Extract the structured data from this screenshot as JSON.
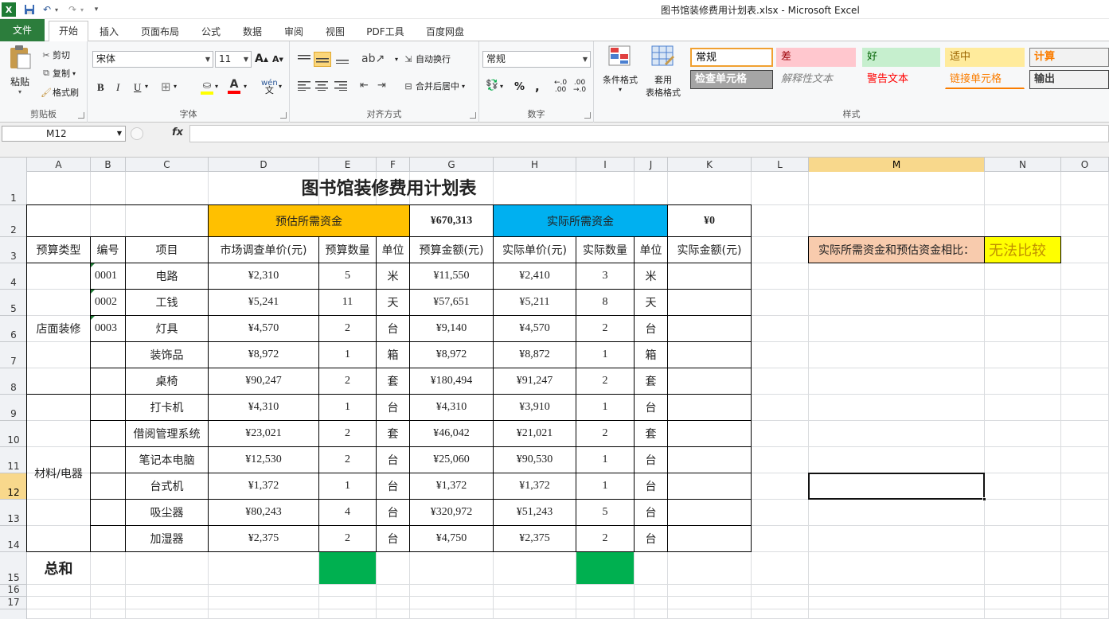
{
  "window": {
    "title": "图书馆装修费用计划表.xlsx - Microsoft Excel"
  },
  "tabs": [
    "文件",
    "开始",
    "插入",
    "页面布局",
    "公式",
    "数据",
    "审阅",
    "视图",
    "PDF工具",
    "百度网盘"
  ],
  "ribbon": {
    "clipboard": {
      "label": "剪贴板",
      "paste": "粘贴",
      "cut": "剪切",
      "copy": "复制",
      "format_painter": "格式刷"
    },
    "font": {
      "label": "字体",
      "font_name": "宋体",
      "font_size": "11"
    },
    "alignment": {
      "label": "对齐方式",
      "wrap": "自动换行",
      "merge": "合并后居中"
    },
    "number": {
      "label": "数字",
      "format": "常规"
    },
    "styles": {
      "label": "样式",
      "cond_format": "条件格式",
      "table_format_1": "套用",
      "table_format_2": "表格格式",
      "cells": [
        {
          "text": "常规",
          "bg": "#ffffff",
          "color": "#000000",
          "border": "#f0a030"
        },
        {
          "text": "差",
          "bg": "#ffc7ce",
          "color": "#9c0006",
          "border": "transparent"
        },
        {
          "text": "好",
          "bg": "#c6efce",
          "color": "#006100",
          "border": "transparent"
        },
        {
          "text": "适中",
          "bg": "#ffeb9c",
          "color": "#9c6500",
          "border": "transparent"
        },
        {
          "text": "计算",
          "bg": "#f2f2f2",
          "color": "#fa7d00",
          "border": "#7f7f7f"
        },
        {
          "text": "检查单元格",
          "bg": "#a5a5a5",
          "color": "#ffffff",
          "border": "#3f3f3f"
        },
        {
          "text": "解释性文本",
          "bg": "transparent",
          "color": "#7f7f7f",
          "border": "transparent"
        },
        {
          "text": "警告文本",
          "bg": "transparent",
          "color": "#ff0000",
          "border": "transparent"
        },
        {
          "text": "链接单元格",
          "bg": "transparent",
          "color": "#fa7d00",
          "border": "transparent"
        },
        {
          "text": "输出",
          "bg": "#f2f2f2",
          "color": "#3f3f3f",
          "border": "#3f3f3f"
        }
      ]
    }
  },
  "formula_bar": {
    "name_box": "M12",
    "fx": "fx",
    "formula": ""
  },
  "columns": [
    "A",
    "B",
    "C",
    "D",
    "E",
    "F",
    "G",
    "H",
    "I",
    "J",
    "K",
    "L",
    "M",
    "N",
    "O"
  ],
  "rows": [
    "1",
    "2",
    "3",
    "4",
    "5",
    "6",
    "7",
    "8",
    "9",
    "10",
    "11",
    "12",
    "13",
    "14",
    "15",
    "16",
    "17"
  ],
  "sheet": {
    "title": "图书馆装修费用计划表",
    "estimated_label": "预估所需资金",
    "estimated_total": "¥670,313",
    "actual_label": "实际所需资金",
    "actual_total": "¥0",
    "headers": [
      "预算类型",
      "编号",
      "项目",
      "市场调查单价(元)",
      "预算数量",
      "单位",
      "预算金额(元)",
      "实际单价(元)",
      "实际数量",
      "单位",
      "实际金额(元)"
    ],
    "category_1": "店面装修",
    "category_2": "材料/电器",
    "total_label": "总和",
    "compare_label": "实际所需资金和预估资金相比：",
    "compare_value": "无法比较",
    "items": [
      {
        "code": "0001",
        "name": "电路",
        "price": "¥2,310",
        "qty": "5",
        "unit": "米",
        "amount": "¥11,550",
        "aprice": "¥2,410",
        "aqty": "3",
        "aunit": "米",
        "aamount": ""
      },
      {
        "code": "0002",
        "name": "工钱",
        "price": "¥5,241",
        "qty": "11",
        "unit": "天",
        "amount": "¥57,651",
        "aprice": "¥5,211",
        "aqty": "8",
        "aunit": "天",
        "aamount": ""
      },
      {
        "code": "0003",
        "name": "灯具",
        "price": "¥4,570",
        "qty": "2",
        "unit": "台",
        "amount": "¥9,140",
        "aprice": "¥4,570",
        "aqty": "2",
        "aunit": "台",
        "aamount": ""
      },
      {
        "code": "",
        "name": "装饰品",
        "price": "¥8,972",
        "qty": "1",
        "unit": "箱",
        "amount": "¥8,972",
        "aprice": "¥8,872",
        "aqty": "1",
        "aunit": "箱",
        "aamount": ""
      },
      {
        "code": "",
        "name": "桌椅",
        "price": "¥90,247",
        "qty": "2",
        "unit": "套",
        "amount": "¥180,494",
        "aprice": "¥91,247",
        "aqty": "2",
        "aunit": "套",
        "aamount": ""
      },
      {
        "code": "",
        "name": "打卡机",
        "price": "¥4,310",
        "qty": "1",
        "unit": "台",
        "amount": "¥4,310",
        "aprice": "¥3,910",
        "aqty": "1",
        "aunit": "台",
        "aamount": ""
      },
      {
        "code": "",
        "name": "借阅管理系统",
        "price": "¥23,021",
        "qty": "2",
        "unit": "套",
        "amount": "¥46,042",
        "aprice": "¥21,021",
        "aqty": "2",
        "aunit": "套",
        "aamount": ""
      },
      {
        "code": "",
        "name": "笔记本电脑",
        "price": "¥12,530",
        "qty": "2",
        "unit": "台",
        "amount": "¥25,060",
        "aprice": "¥90,530",
        "aqty": "1",
        "aunit": "台",
        "aamount": ""
      },
      {
        "code": "",
        "name": "台式机",
        "price": "¥1,372",
        "qty": "1",
        "unit": "台",
        "amount": "¥1,372",
        "aprice": "¥1,372",
        "aqty": "1",
        "aunit": "台",
        "aamount": ""
      },
      {
        "code": "",
        "name": "吸尘器",
        "price": "¥80,243",
        "qty": "4",
        "unit": "台",
        "amount": "¥320,972",
        "aprice": "¥51,243",
        "aqty": "5",
        "aunit": "台",
        "aamount": ""
      },
      {
        "code": "",
        "name": "加湿器",
        "price": "¥2,375",
        "qty": "2",
        "unit": "台",
        "amount": "¥4,750",
        "aprice": "¥2,375",
        "aqty": "2",
        "aunit": "台",
        "aamount": ""
      }
    ]
  },
  "colors": {
    "estimated_bg": "#ffc000",
    "actual_bg": "#00b0f0",
    "total_green": "#00b050",
    "compare_label_bg": "#f8cbad",
    "compare_value_bg": "#ffff00",
    "compare_value_color": "#c09000",
    "file_tab_bg": "#2c7d3c",
    "selected_header": "#f8d88c"
  }
}
